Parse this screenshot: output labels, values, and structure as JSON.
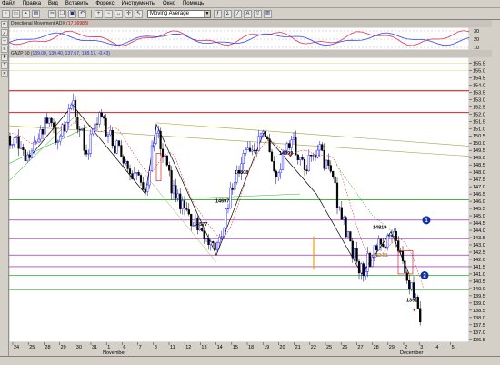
{
  "menu": [
    "Файл",
    "Правка",
    "Вид",
    "Вставить",
    "Форекс",
    "Инструменты",
    "Окно",
    "Помощь"
  ],
  "toolbar": {
    "left_icons": [
      "new",
      "open",
      "save",
      "print",
      "cut",
      "copy",
      "paste",
      "undo",
      "zoom-in",
      "zoom-out",
      "fit",
      "crosshair",
      "arrow"
    ],
    "indicator_select": "Moving Average",
    "right_icons": [
      "fx",
      "sigma",
      "line",
      "text",
      "arrow-up",
      "chart"
    ]
  },
  "dmi_panel": {
    "title": "Directional Movement ADX",
    "value": "(17.66988)",
    "scale": [
      "30",
      "20",
      "10"
    ],
    "color_red": "#e03050",
    "color_blue": "#3040ff"
  },
  "price_panel": {
    "title": "GAZP 60",
    "values": "(139.00, 139.40, 137.67, 138.17, -0.43)",
    "scale": [
      "155.5",
      "155.0",
      "154.5",
      "154.0",
      "153.5",
      "153.0",
      "152.5",
      "152.0",
      "151.5",
      "151.0",
      "150.5",
      "150.0",
      "149.5",
      "149.0",
      "148.5",
      "148.0",
      "147.5",
      "147.0",
      "146.5",
      "146.0",
      "145.5",
      "145.0",
      "144.5",
      "144.0",
      "143.5",
      "143.0",
      "142.5",
      "142.0",
      "141.5",
      "141.0",
      "140.5",
      "140.0",
      "139.5",
      "139.0",
      "138.5",
      "138.0",
      "137.5",
      "137.0",
      "136.5"
    ],
    "labels": {
      "low_1": "14577",
      "mid_1": "14697",
      "mid_2": "14808",
      "high_1": "14999",
      "high_2": "15160",
      "mid_3": "14819",
      "target": "1391",
      "small_1": "143.81",
      "badge_1": "1",
      "badge_2": "2"
    },
    "colors": {
      "candle_up": "#0000ff",
      "candle_down": "#000000",
      "green_line": "#00a000",
      "red_line": "#d00000",
      "purple_line": "#9000a0",
      "olive_line": "#a0a040",
      "orange": "#f0a000"
    }
  },
  "xaxis": {
    "days": [
      "24",
      "25",
      "28",
      "29",
      "30",
      "31",
      "1",
      "6",
      "7",
      "8",
      "11",
      "12",
      "13",
      "14",
      "15",
      "18",
      "19",
      "20",
      "21",
      "22",
      "25",
      "26",
      "27",
      "28",
      "29",
      "2",
      "3",
      "4",
      "5"
    ],
    "months": [
      "November",
      "December"
    ]
  }
}
